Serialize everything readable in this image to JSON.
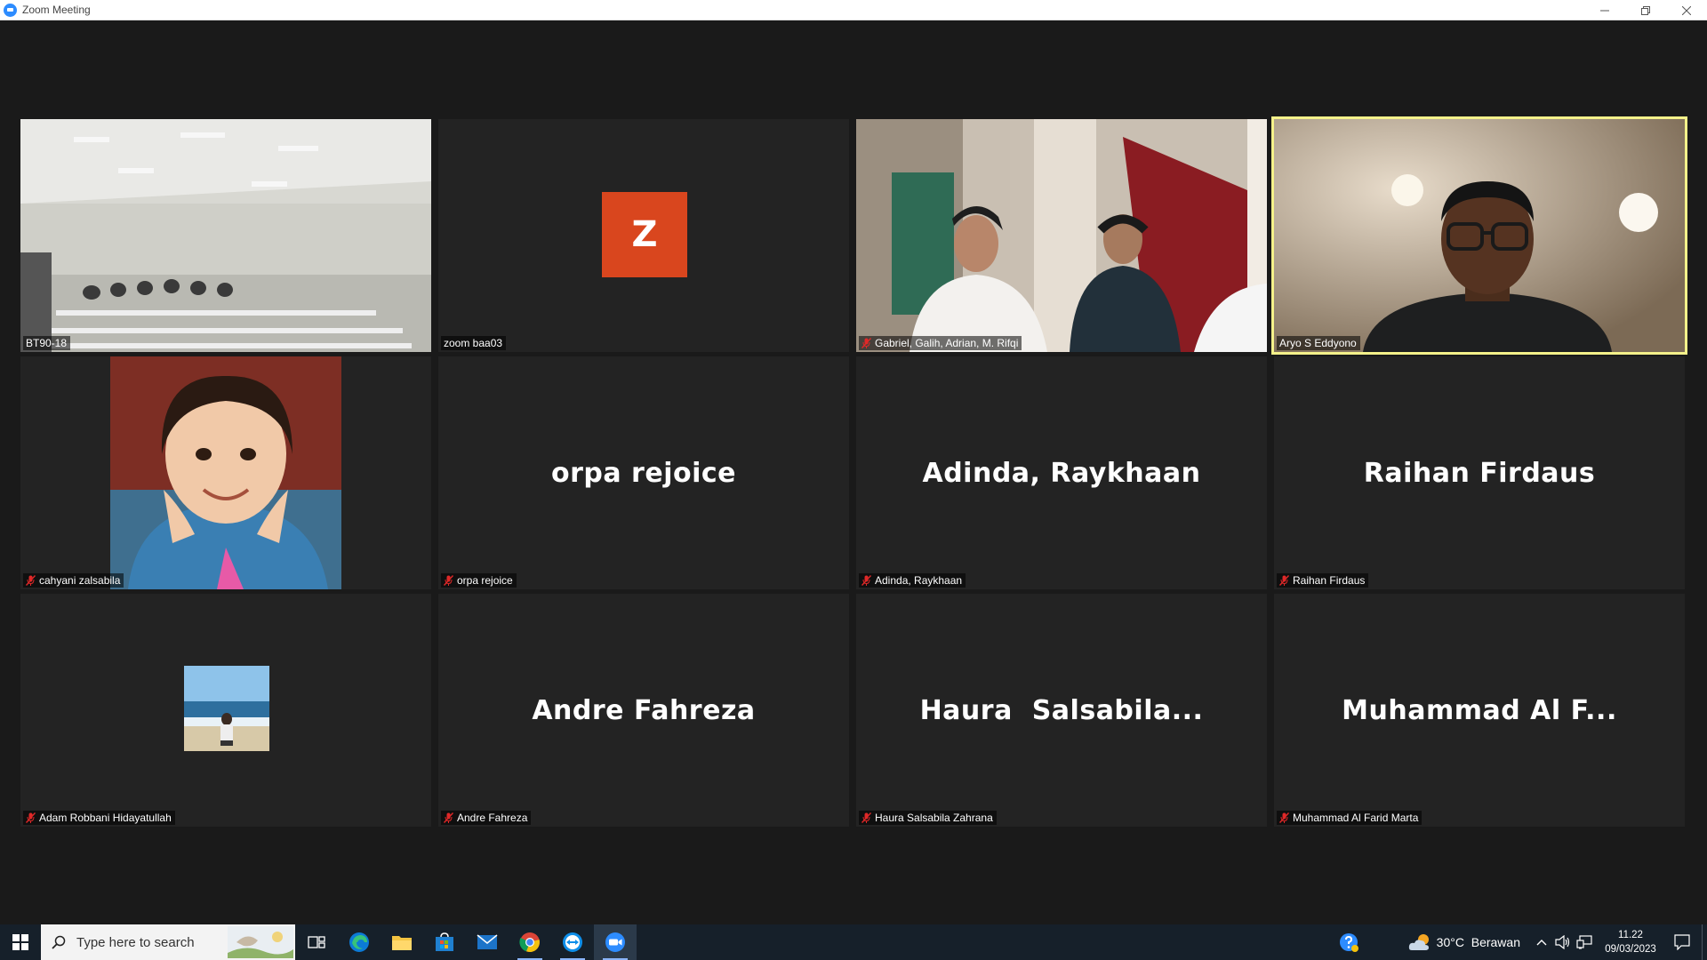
{
  "window": {
    "title": "Zoom Meeting",
    "controls": [
      "minimize",
      "restore",
      "close"
    ]
  },
  "participants": [
    {
      "name": "BT90-18",
      "muted": false,
      "video": "classroom"
    },
    {
      "name": "zoom baa03",
      "muted": false,
      "avatar_letter": "Z",
      "avatar_color": "#d9461e"
    },
    {
      "name": "Gabriel, Galih, Adrian, M. Rifqi",
      "muted": true,
      "video": "two-people"
    },
    {
      "name": "Aryo S Eddyono",
      "muted": false,
      "video": "person-glasses",
      "speaking": true
    },
    {
      "name": "cahyani zalsabila",
      "muted": true,
      "video": "child-photo"
    },
    {
      "name": "orpa rejoice",
      "muted": true,
      "display_name": "orpa rejoice"
    },
    {
      "name": "Adinda, Raykhaan",
      "muted": true,
      "display_name": "Adinda, Raykhaan"
    },
    {
      "name": "Raihan Firdaus",
      "muted": true,
      "display_name": "Raihan Firdaus"
    },
    {
      "name": "Adam Robbani Hidayatullah",
      "muted": true,
      "video": "beach-photo"
    },
    {
      "name": "Andre Fahreza",
      "muted": true,
      "display_name": "Andre Fahreza"
    },
    {
      "name": "Haura Salsabila Zahrana",
      "muted": true,
      "display_name": "Haura  Salsabila..."
    },
    {
      "name": "Muhammad Al Farid Marta",
      "muted": true,
      "display_name": "Muhammad Al F..."
    }
  ],
  "taskbar": {
    "search_placeholder": "Type here to search",
    "apps": [
      "task-view",
      "edge",
      "file-explorer",
      "microsoft-store",
      "mail",
      "chrome",
      "teamviewer",
      "zoom"
    ],
    "weather": "30°C  Berawan",
    "time": "11.22",
    "date": "09/03/2023",
    "accent": "#2d8cff"
  }
}
